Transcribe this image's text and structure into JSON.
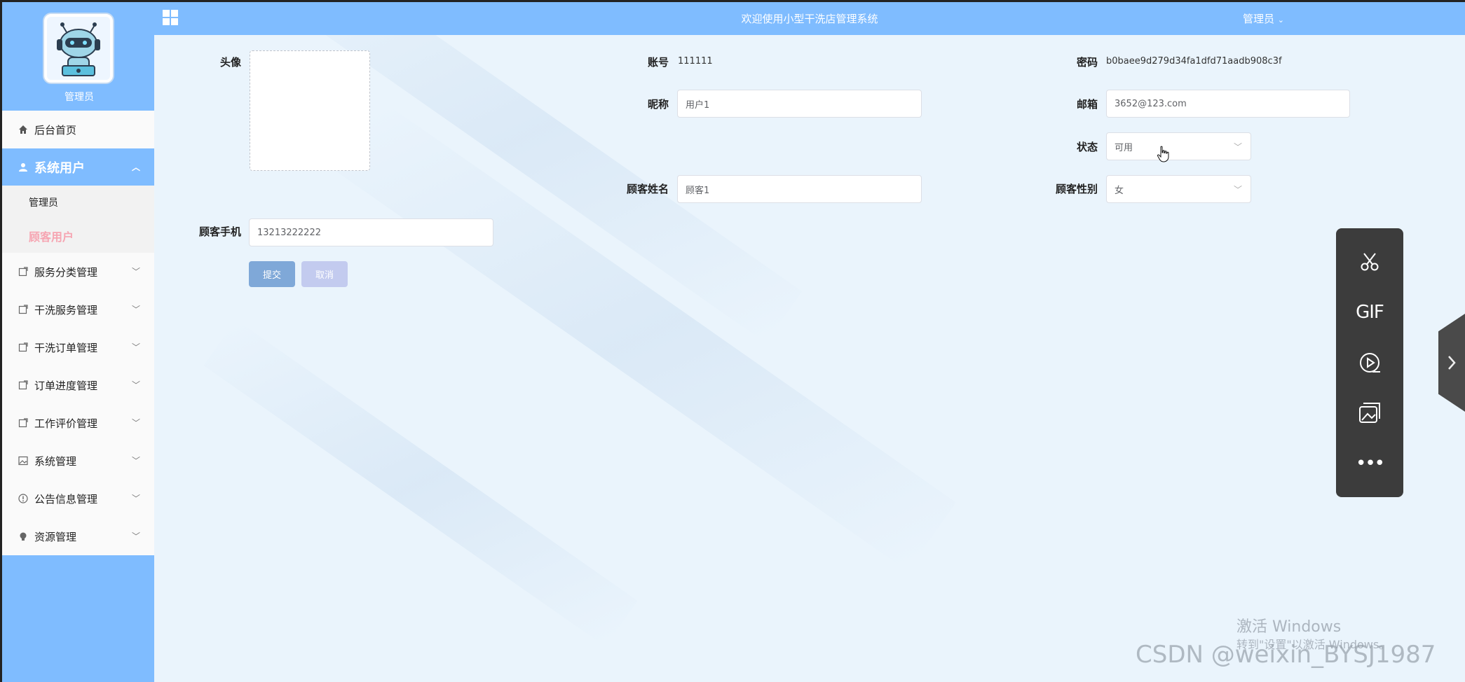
{
  "header": {
    "title": "欢迎使用小型干洗店管理系统",
    "user_menu": "管理员",
    "user_menu_arrow": "⌄"
  },
  "sidebar": {
    "admin_label": "管理员",
    "items": [
      {
        "label": "后台首页",
        "icon": "home-icon"
      },
      {
        "label": "系统用户",
        "icon": "user-icon",
        "active": true
      },
      {
        "label": "服务分类管理",
        "icon": "doc-icon"
      },
      {
        "label": "干洗服务管理",
        "icon": "doc-icon"
      },
      {
        "label": "干洗订单管理",
        "icon": "doc-icon"
      },
      {
        "label": "订单进度管理",
        "icon": "doc-icon"
      },
      {
        "label": "工作评价管理",
        "icon": "doc-icon"
      },
      {
        "label": "系统管理",
        "icon": "picture-icon"
      },
      {
        "label": "公告信息管理",
        "icon": "info-icon"
      },
      {
        "label": "资源管理",
        "icon": "bulb-icon"
      }
    ],
    "sub_items": [
      {
        "label": "管理员"
      },
      {
        "label": "顾客用户",
        "current": true
      }
    ]
  },
  "form": {
    "avatar_label": "头像",
    "account_label": "账号",
    "account_value": "111111",
    "password_label": "密码",
    "password_value": "b0baee9d279d34fa1dfd71aadb908c3f",
    "nickname_label": "昵称",
    "nickname_value": "用户1",
    "email_label": "邮箱",
    "email_value": "3652@123.com",
    "status_label": "状态",
    "status_value": "可用",
    "customer_name_label": "顾客姓名",
    "customer_name_value": "顾客1",
    "customer_gender_label": "顾客性别",
    "customer_gender_value": "女",
    "customer_phone_label": "顾客手机",
    "customer_phone_value": "13213222222",
    "submit_label": "提交",
    "cancel_label": "取消"
  },
  "float_toolbar": {
    "gif_label": "GIF",
    "more_label": "•••"
  },
  "watermarks": {
    "activate_title": "激活 Windows",
    "activate_sub": "转到\"设置\"以激活 Windows。",
    "csdn": "CSDN @weixin_BYSJ1987"
  }
}
